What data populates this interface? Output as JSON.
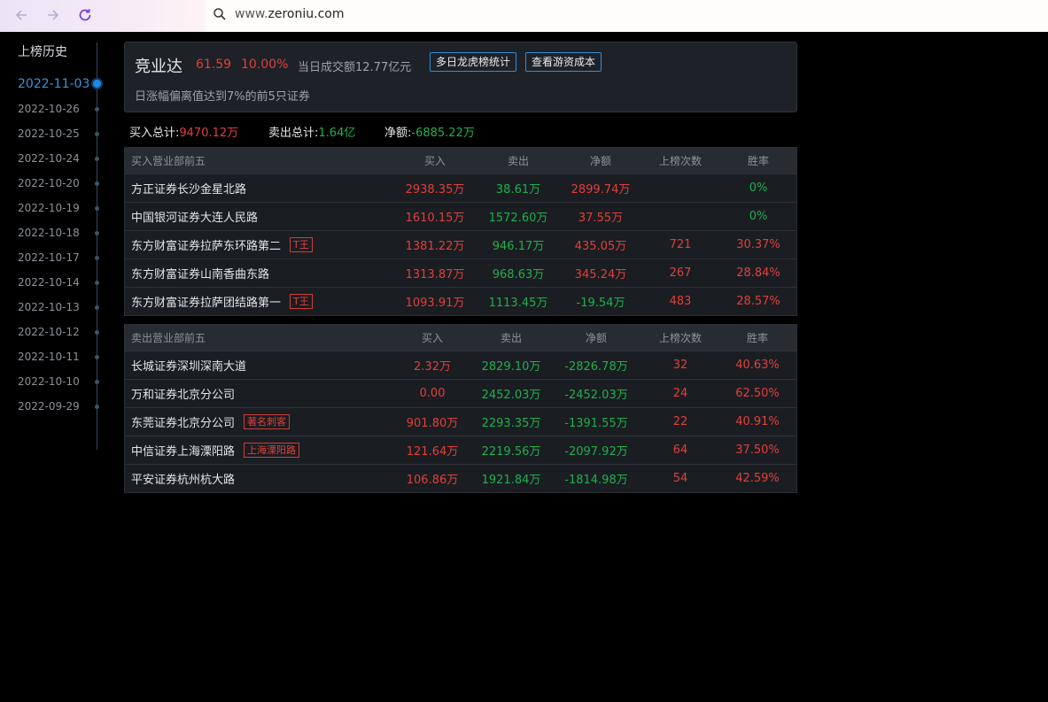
{
  "browser": {
    "url_prefix": "www.",
    "url_domain": "zeroniu.com"
  },
  "sidebar": {
    "title": "上榜历史",
    "dates": [
      "2022-11-03",
      "2022-10-26",
      "2022-10-25",
      "2022-10-24",
      "2022-10-20",
      "2022-10-19",
      "2022-10-18",
      "2022-10-17",
      "2022-10-14",
      "2022-10-13",
      "2022-10-12",
      "2022-10-11",
      "2022-10-10",
      "2022-09-29"
    ]
  },
  "stock": {
    "name": "竞业达",
    "price": "61.59",
    "change_pct": "10.00%",
    "turnover": "当日成交额12.77亿元",
    "btn_multi_day": "多日龙虎榜统计",
    "btn_cost": "查看游资成本",
    "reason": "日涨幅偏离值达到7%的前5只证券"
  },
  "summary": {
    "buy_label": "买入总计:",
    "buy_value": "9470.12万",
    "sell_label": "卖出总计:",
    "sell_value": "1.64亿",
    "net_label": "净额:",
    "net_value": "-6885.22万"
  },
  "buy_table": {
    "headers": [
      "买入营业部前五",
      "买入",
      "卖出",
      "净额",
      "上榜次数",
      "胜率"
    ],
    "rows": [
      {
        "name": "方正证券长沙金星北路",
        "tag": "",
        "buy": "2938.35万",
        "sell": "38.61万",
        "net": "2899.74万",
        "count": "",
        "win": "0%"
      },
      {
        "name": "中国银河证券大连人民路",
        "tag": "",
        "buy": "1610.15万",
        "sell": "1572.60万",
        "net": "37.55万",
        "count": "",
        "win": "0%"
      },
      {
        "name": "东方财富证券拉萨东环路第二",
        "tag": "T王",
        "buy": "1381.22万",
        "sell": "946.17万",
        "net": "435.05万",
        "count": "721",
        "win": "30.37%"
      },
      {
        "name": "东方财富证券山南香曲东路",
        "tag": "",
        "buy": "1313.87万",
        "sell": "968.63万",
        "net": "345.24万",
        "count": "267",
        "win": "28.84%"
      },
      {
        "name": "东方财富证券拉萨团结路第一",
        "tag": "T王",
        "buy": "1093.91万",
        "sell": "1113.45万",
        "net": "-19.54万",
        "count": "483",
        "win": "28.57%"
      }
    ]
  },
  "sell_table": {
    "headers": [
      "卖出营业部前五",
      "买入",
      "卖出",
      "净额",
      "上榜次数",
      "胜率"
    ],
    "rows": [
      {
        "name": "长城证券深圳深南大道",
        "tag": "",
        "buy": "2.32万",
        "sell": "2829.10万",
        "net": "-2826.78万",
        "count": "32",
        "win": "40.63%"
      },
      {
        "name": "万和证券北京分公司",
        "tag": "",
        "buy": "0.00",
        "sell": "2452.03万",
        "net": "-2452.03万",
        "count": "24",
        "win": "62.50%"
      },
      {
        "name": "东莞证券北京分公司",
        "tag": "著名刺客",
        "buy": "901.80万",
        "sell": "2293.35万",
        "net": "-1391.55万",
        "count": "22",
        "win": "40.91%"
      },
      {
        "name": "中信证券上海溧阳路",
        "tag": "上海溧阳路",
        "buy": "121.64万",
        "sell": "2219.56万",
        "net": "-2097.92万",
        "count": "64",
        "win": "37.50%"
      },
      {
        "name": "平安证券杭州杭大路",
        "tag": "",
        "buy": "106.86万",
        "sell": "1921.84万",
        "net": "-1814.98万",
        "count": "54",
        "win": "42.59%"
      }
    ]
  },
  "colors": {
    "up": "#e0403a",
    "down": "#21b04b",
    "accent": "#1e88e5"
  }
}
